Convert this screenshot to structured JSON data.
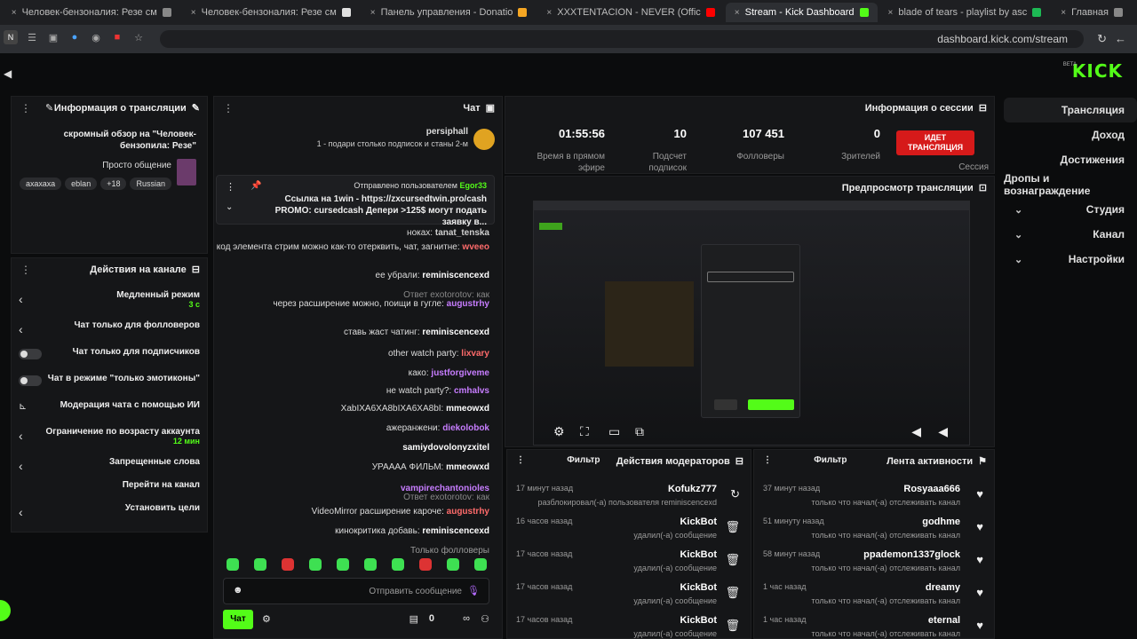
{
  "browser": {
    "tabs": [
      {
        "label": "Главная",
        "color": "#888888"
      },
      {
        "label": "blade of tears - playlist by asc",
        "color": "#1db954"
      },
      {
        "label": "Stream - Kick Dashboard",
        "color": "#53fc18"
      },
      {
        "label": "XXXTENTACION - NEVER (Offic",
        "color": "#ff0000"
      },
      {
        "label": "Панель управления - Donatio",
        "color": "#f5a623"
      },
      {
        "label": "Человек-бензоналия: Резе см",
        "color": "#e0e0e0"
      },
      {
        "label": "Человек-бензоналия: Резе см",
        "color": "#888888"
      }
    ],
    "url": "dashboard.kick.com/stream"
  },
  "kick": {
    "logo": "KICK",
    "beta": "BETA"
  },
  "nav": {
    "items": [
      "Трансляция",
      "Доход",
      "Достижения",
      "Дропы и вознаграждение",
      "Студия",
      "Канал",
      "Настройки"
    ]
  },
  "session": {
    "title": "Информация о сессии",
    "live_label": "ИДЕТ ТРАНСЛЯЦИЯ",
    "session_label": "Сессия",
    "stats": [
      {
        "value": "0",
        "label": "Зрителей"
      },
      {
        "value": "107 451",
        "label": "Фолловеры"
      },
      {
        "value": "10",
        "label": "Подсчет подписок"
      },
      {
        "value": "01:55:56",
        "label": "Время в прямом эфире"
      }
    ]
  },
  "preview": {
    "title": "Предпросмотр трансляции"
  },
  "activity": {
    "title": "Лента активности",
    "filter": "Фильтр",
    "items": [
      {
        "name": "Rosyaaa666",
        "desc": "только что начал(-а) отслеживать канал",
        "time": "37 минут назад"
      },
      {
        "name": "godhme",
        "desc": "только что начал(-а) отслеживать канал",
        "time": "51 минуту назад"
      },
      {
        "name": "ppademon1337glock",
        "desc": "только что начал(-а) отслеживать канал",
        "time": "58 минут назад"
      },
      {
        "name": "dreamy",
        "desc": "только что начал(-а) отслеживать канал",
        "time": "1 час назад"
      },
      {
        "name": "eternal",
        "desc": "только что начал(-а) отслеживать канал",
        "time": "1 час назад"
      }
    ]
  },
  "modactions": {
    "title": "Действия модераторов",
    "filter": "Фильтр",
    "items": [
      {
        "name": "Kofukz777",
        "desc": "разблокировал(-а) пользователя reminiscencexd",
        "time": "17 минут назад"
      },
      {
        "name": "KickBot",
        "desc": "удалил(-а) сообщение",
        "time": "16 часов назад"
      },
      {
        "name": "KickBot",
        "desc": "удалил(-а) сообщение",
        "time": "17 часов назад"
      },
      {
        "name": "KickBot",
        "desc": "удалил(-а) сообщение",
        "time": "17 часов назад"
      },
      {
        "name": "KickBot",
        "desc": "удалил(-а) сообщение",
        "time": "17 часов назад"
      }
    ]
  },
  "chat": {
    "title": "Чат",
    "gift_user": "persiphall",
    "gift_text": "1 - подари столько подписок и станы 2-м",
    "pinned_label": "Отправлено пользователем",
    "pinned_user": "Egor33",
    "pinned_text": "Ссылка на 1win - https://zxcursedtwin.pro/cash PROMO: cursedcash Депери >125$ могут подать заявку в...",
    "messages": [
      {
        "user": "tanat_tenska",
        "text": "ноках",
        "color": "#cfcfcf"
      },
      {
        "user": "wveeo",
        "text": "через код элемента стрим можно как-то отерквить, чат, загнитне",
        "color": "#ff6b6b"
      },
      {
        "user": "reminiscencexd",
        "text": "ее убрали",
        "color": "#ffffff"
      },
      {
        "user": "augustrhy",
        "text": "через расширение можно, поищи в гугле",
        "color": "#c77dff"
      },
      {
        "user": "reminiscencexd",
        "text": "ставь жаст чатинг",
        "color": "#ffffff"
      },
      {
        "user": "lixvary",
        "text": "other watch party",
        "color": "#ff6b6b"
      },
      {
        "user": "justforgiveme",
        "text": "како",
        "color": "#c77dff"
      },
      {
        "user": "cmhalvs",
        "text": "не watch party?",
        "color": "#c77dff"
      },
      {
        "user": "mmeowxd",
        "text": "XabIXA6XA8bIXA6XA8bI",
        "color": "#ffffff"
      },
      {
        "user": "diekolobok",
        "text": "ажеранжени",
        "color": "#c77dff"
      },
      {
        "user": "samiydovolonyzxitel",
        "text": "",
        "color": "#ffffff"
      },
      {
        "user": "mmeowxd",
        "text": "УРАААА ФИЛЬМ",
        "color": "#ffffff"
      },
      {
        "user": "vampirechantonioles",
        "text": "",
        "color": "#c77dff"
      },
      {
        "user": "augustrhy",
        "text": "VideoMirror расширение кароче",
        "color": "#ff6b6b"
      },
      {
        "user": "reminiscencexd",
        "text": "кинокритика добавь",
        "color": "#ffffff"
      }
    ],
    "reply_label": "Ответ exotorotov: как",
    "reply_label2": "Ответ exotorotov: как",
    "followers_only": "Только фолловеры",
    "input_placeholder": "Отправить сообщение",
    "send_button": "Чат",
    "count": "0"
  },
  "streaminfo": {
    "title": "Информация о трансляции",
    "stream_title": "скромный обзор на \"Человек-бензопила: Резе\"",
    "category": "Просто общение",
    "tags": [
      "Russian",
      "18+",
      "eblan",
      "ахахаха"
    ]
  },
  "channelactions": {
    "title": "Действия на канале",
    "items": [
      {
        "label": "Медленный режим",
        "sub": "3 с",
        "control": "chevron"
      },
      {
        "label": "Чат только для фолловеров",
        "sub": "",
        "control": "chevron"
      },
      {
        "label": "Чат только для подписчиков",
        "sub": "",
        "control": "toggle"
      },
      {
        "label": "Чат в режиме \"только эмотиконы\"",
        "sub": "",
        "control": "toggle"
      },
      {
        "label": "Модерация чата с помощью ИИ",
        "sub": "",
        "control": "icon"
      },
      {
        "label": "Ограничение по возрасту аккаунта",
        "sub": "12 мин",
        "control": "chevron"
      },
      {
        "label": "Запрещенные слова",
        "sub": "",
        "control": "chevron"
      },
      {
        "label": "Перейти на канал",
        "sub": "",
        "control": "none"
      },
      {
        "label": "Установить цели",
        "sub": "",
        "control": "chevron"
      }
    ]
  }
}
